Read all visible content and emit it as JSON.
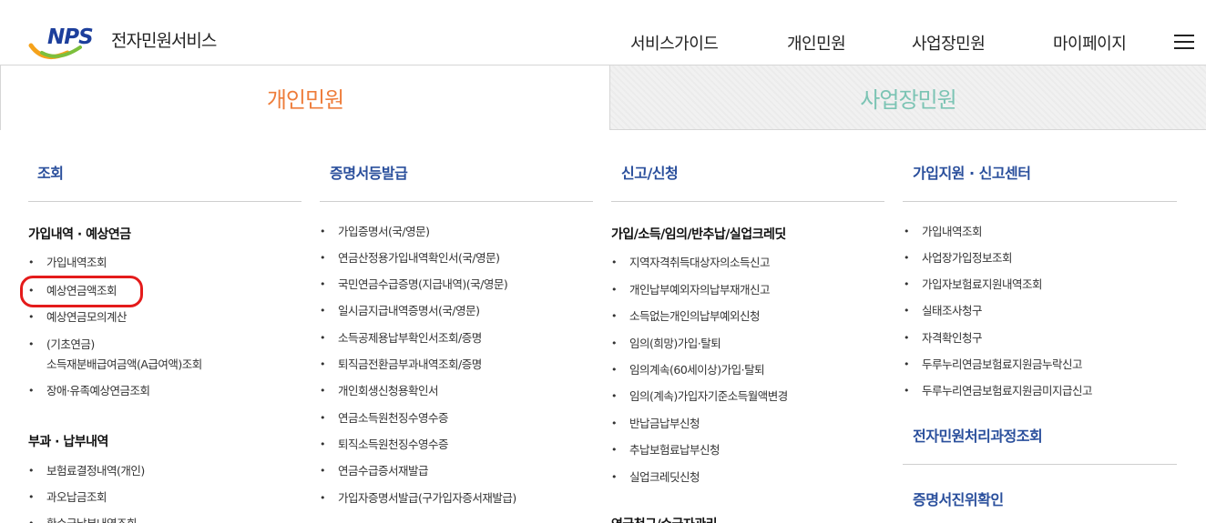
{
  "header": {
    "logo_mark": "NPS",
    "site_title": "전자민원서비스",
    "nav": [
      "서비스가이드",
      "개인민원",
      "사업장민원",
      "마이페이지"
    ],
    "menu_icon": "hamburger-icon"
  },
  "tabs": {
    "personal": "개인민원",
    "business": "사업장민원"
  },
  "columns": {
    "c1": {
      "title": "조회",
      "group1": "가입내역 · 예상연금",
      "items1": [
        "가입내역조회",
        "예상연금액조회",
        "예상연금모의계산"
      ],
      "item_basic_1": "(기초연금)",
      "item_basic_2": "소득재분배급여금액(A급여액)조회",
      "item_last1": "장애·유족예상연금조회",
      "group2": "부과 · 납부내역",
      "items2": [
        "보험료결정내역(개인)",
        "과오납금조회",
        "환수금납부내역조회"
      ]
    },
    "c2": {
      "title": "증명서등발급",
      "items": [
        "가입증명서(국/영문)",
        "연금산정용가입내역확인서(국/영문)",
        "국민연금수급증명(지급내역)(국/영문)",
        "일시금지급내역증명서(국/영문)",
        "소득공제용납부확인서조회/증명",
        "퇴직금전환금부과내역조회/증명",
        "개인회생신청용확인서",
        "연금소득원천징수영수증",
        "퇴직소득원천징수영수증",
        "연금수급증서재발급",
        "가입자증명서발급(구가입자증서재발급)"
      ]
    },
    "c3": {
      "title": "신고/신청",
      "group1": "가입/소득/임의/반추납/실업크레딧",
      "items": [
        "지역자격취득대상자의소득신고",
        "개인납부예외자의납부재개신고",
        "소득없는개인의납부예외신청",
        "임의(희망)가입·탈퇴",
        "임의계속(60세이상)가입·탈퇴",
        "임의(계속)가입자기준소득월액변경",
        "반납금납부신청",
        "추납보험료납부신청",
        "실업크레딧신청"
      ],
      "group2": "연금청구/수급자관리"
    },
    "c4": {
      "title": "가입지원 · 신고센터",
      "items": [
        "가입내역조회",
        "사업장가입정보조회",
        "가입자보험료지원내역조회",
        "실태조사청구",
        "자격확인청구",
        "두루누리연금보험료지원금누락신고",
        "두루누리연금보험료지원금미지급신고"
      ],
      "section2": "전자민원처리과정조회",
      "section3": "증명서진위확인"
    }
  },
  "colors": {
    "brand_blue": "#2a4f9c",
    "tab_active": "#ee7d3b",
    "tab_inactive": "#7cc4b4",
    "highlight_red": "#e41b1b"
  }
}
